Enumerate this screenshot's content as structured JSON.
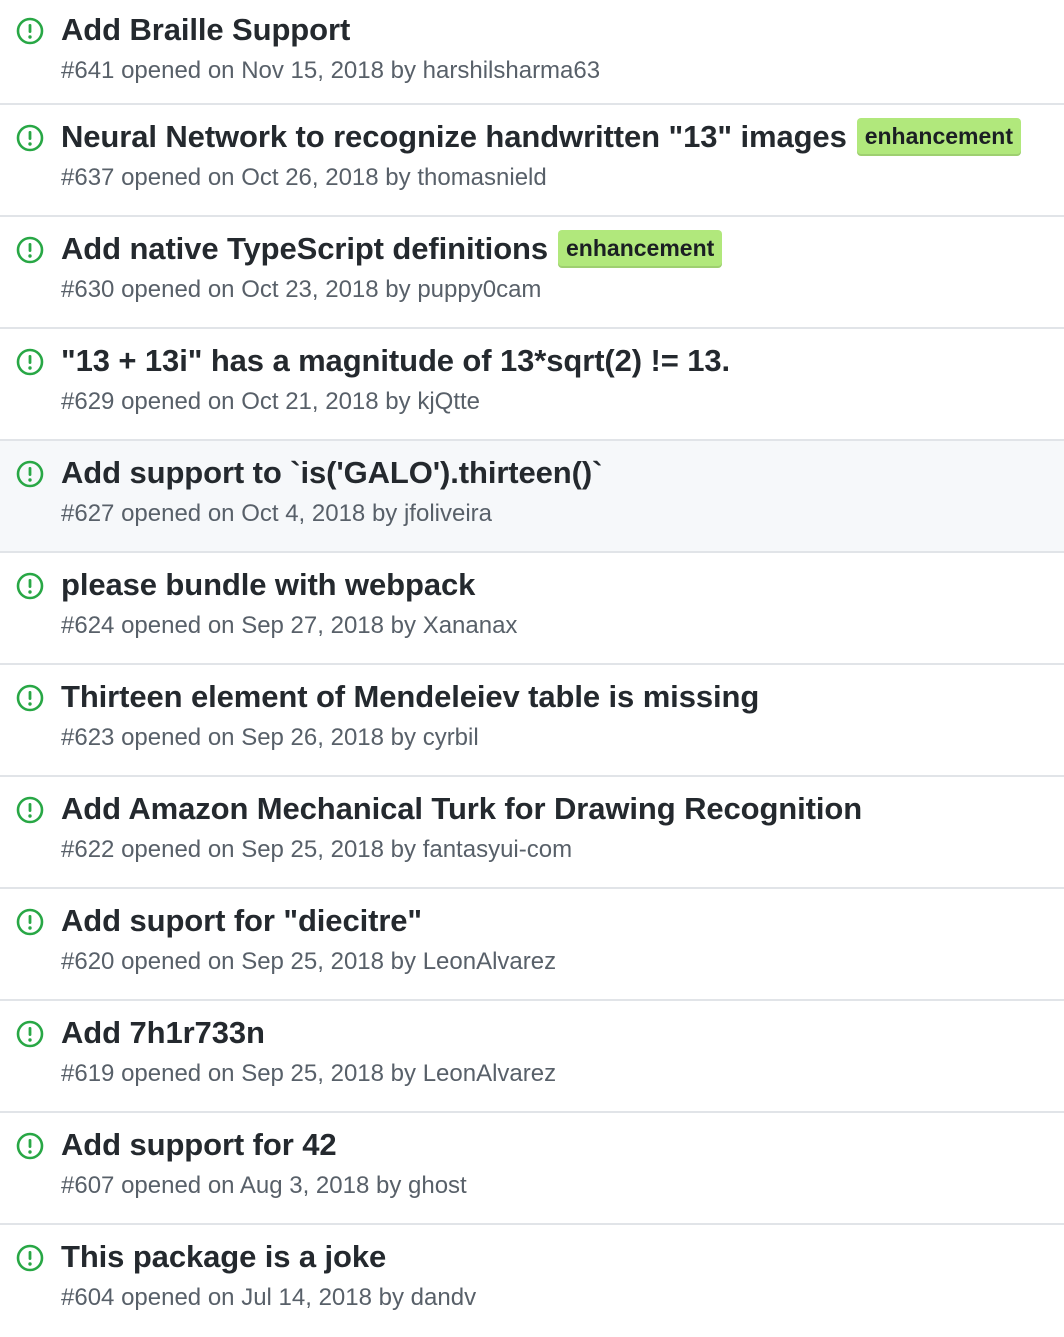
{
  "colors": {
    "open_icon": "#28a745",
    "label_enhancement": "#b1e87c",
    "title_text": "#24292e",
    "meta_text": "#586069",
    "divider": "#e1e4e8",
    "hover_row": "#f6f8fa"
  },
  "issues": [
    {
      "title": "Add Braille Support",
      "number": "#641",
      "opened_text": "opened on",
      "date": "Nov 15, 2018",
      "by_text": "by",
      "author": "harshilsharma63",
      "labels": []
    },
    {
      "title": "Neural Network to recognize handwritten \"13\" images",
      "number": "#637",
      "opened_text": "opened on",
      "date": "Oct 26, 2018",
      "by_text": "by",
      "author": "thomasnield",
      "labels": [
        "enhancement"
      ]
    },
    {
      "title": "Add native TypeScript definitions",
      "number": "#630",
      "opened_text": "opened on",
      "date": "Oct 23, 2018",
      "by_text": "by",
      "author": "puppy0cam",
      "labels": [
        "enhancement"
      ]
    },
    {
      "title": "\"13 + 13i\" has a magnitude of 13*sqrt(2) != 13.",
      "number": "#629",
      "opened_text": "opened on",
      "date": "Oct 21, 2018",
      "by_text": "by",
      "author": "kjQtte",
      "labels": []
    },
    {
      "title": "Add support to `is('GALO').thirteen()`",
      "number": "#627",
      "opened_text": "opened on",
      "date": "Oct 4, 2018",
      "by_text": "by",
      "author": "jfoliveira",
      "labels": [],
      "hovered": true
    },
    {
      "title": "please bundle with webpack",
      "number": "#624",
      "opened_text": "opened on",
      "date": "Sep 27, 2018",
      "by_text": "by",
      "author": "Xananax",
      "labels": []
    },
    {
      "title": "Thirteen element of Mendeleiev table is missing",
      "number": "#623",
      "opened_text": "opened on",
      "date": "Sep 26, 2018",
      "by_text": "by",
      "author": "cyrbil",
      "labels": []
    },
    {
      "title": "Add Amazon Mechanical Turk for Drawing Recognition",
      "number": "#622",
      "opened_text": "opened on",
      "date": "Sep 25, 2018",
      "by_text": "by",
      "author": "fantasyui-com",
      "labels": []
    },
    {
      "title": "Add suport for \"diecitre\"",
      "number": "#620",
      "opened_text": "opened on",
      "date": "Sep 25, 2018",
      "by_text": "by",
      "author": "LeonAlvarez",
      "labels": []
    },
    {
      "title": "Add 7h1r733n",
      "number": "#619",
      "opened_text": "opened on",
      "date": "Sep 25, 2018",
      "by_text": "by",
      "author": "LeonAlvarez",
      "labels": []
    },
    {
      "title": "Add support for 42",
      "number": "#607",
      "opened_text": "opened on",
      "date": "Aug 3, 2018",
      "by_text": "by",
      "author": "ghost",
      "labels": []
    },
    {
      "title": "This package is a joke",
      "number": "#604",
      "opened_text": "opened on",
      "date": "Jul 14, 2018",
      "by_text": "by",
      "author": "dandv",
      "labels": []
    }
  ]
}
